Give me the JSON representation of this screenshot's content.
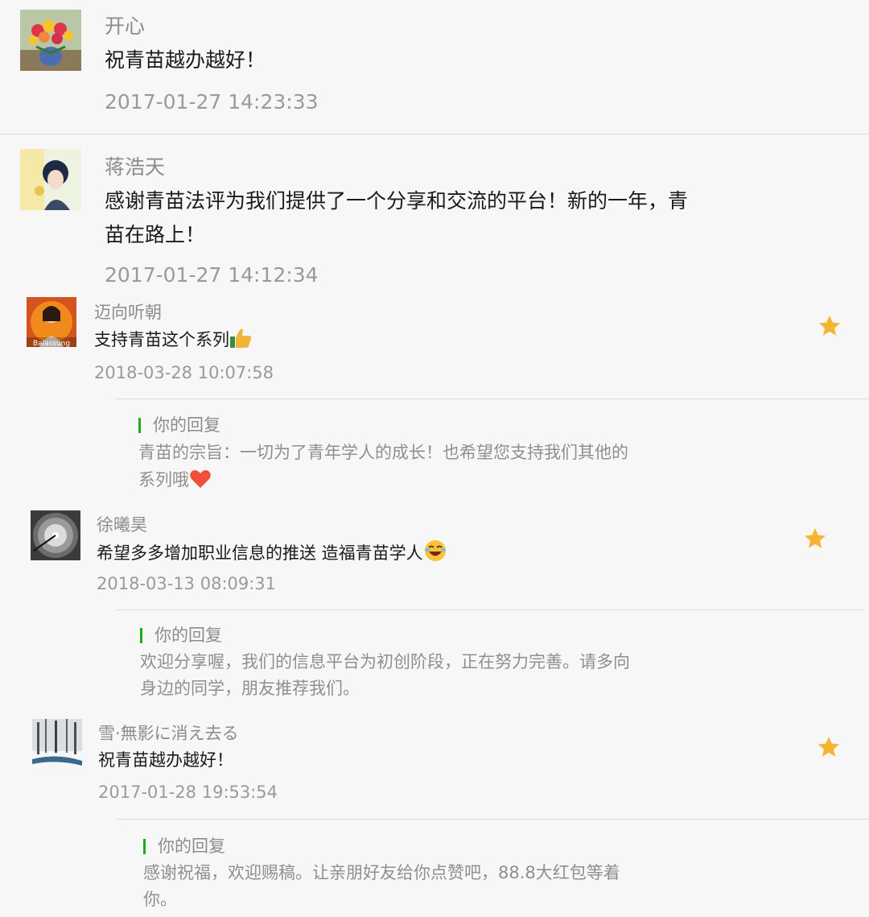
{
  "comments": [
    {
      "name": "开心",
      "content": "祝青苗越办越好！",
      "time": "2017-01-27 14:23:33"
    },
    {
      "name": "蒋浩天",
      "content_line1": "感谢青苗法评为我们提供了一个分享和交流的平台！新的一年，青",
      "content_line2": "苗在路上！",
      "time": "2017-01-27 14:12:34"
    },
    {
      "name": "迈向听朝",
      "content": "支持青苗这个系列",
      "emoji": "thumbs-up-emoji",
      "avatar_text": "Balassung",
      "time": "2018-03-28 10:07:58",
      "featured": true,
      "reply": {
        "label": "你的回复",
        "line1": "青苗的宗旨：一切为了青年学人的成长！也希望您支持我们其他的",
        "line2": "系列哦",
        "emoji": "heart-emoji"
      }
    },
    {
      "name": "徐曦昊",
      "content": "希望多多增加职业信息的推送 造福青苗学人",
      "emoji": "laughing-emoji",
      "time": "2018-03-13 08:09:31",
      "featured": true,
      "reply": {
        "label": "你的回复",
        "line1": "欢迎分享喔，我们的信息平台为初创阶段，正在努力完善。请多向",
        "line2": "身边的同学，朋友推荐我们。"
      }
    },
    {
      "name": "雪·無影に消え去る",
      "content": "祝青苗越办越好！",
      "time": "2017-01-28 19:53:54",
      "featured": true,
      "reply": {
        "label": "你的回复",
        "line1": "感谢祝福，欢迎赐稿。让亲朋好友给你点赞吧，88.8大红包等着",
        "line2": "你。"
      }
    }
  ],
  "colors": {
    "star": "#f5b433",
    "reply_bar": "#1aad19",
    "name": "#8c8c8c",
    "time": "#9a9a9a"
  }
}
